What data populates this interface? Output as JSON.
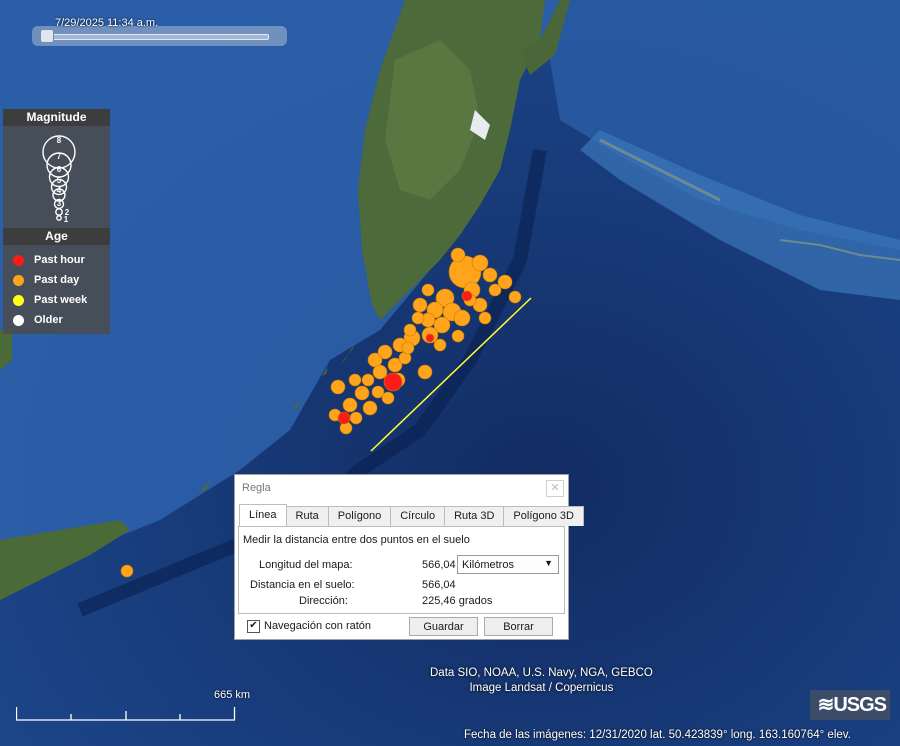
{
  "time_slider": {
    "label": "7/29/2025  11:34 a.m.",
    "position": 0.02
  },
  "legend": {
    "magnitude_title": "Magnitude",
    "magnitude_labels": [
      "8",
      "7",
      "6",
      "5",
      "4",
      "3",
      "2",
      "1"
    ],
    "age_title": "Age",
    "ages": [
      {
        "label": "Past hour",
        "color": "#ff1a1a"
      },
      {
        "label": "Past day",
        "color": "#ffa41b"
      },
      {
        "label": "Past week",
        "color": "#ffff1a"
      },
      {
        "label": "Older",
        "color": "#ffffff"
      }
    ]
  },
  "ruler_dialog": {
    "title": "Regla",
    "close_icon": "close-icon",
    "tabs": [
      "Línea",
      "Ruta",
      "Polígono",
      "Círculo",
      "Ruta 3D",
      "Polígono 3D"
    ],
    "active_tab": "Línea",
    "description": "Medir la distancia entre dos puntos en el suelo",
    "map_length_label": "Longitud del mapa:",
    "map_length_value": "566,04",
    "unit_select": "Kilómetros",
    "ground_distance_label": "Distancia en el suelo:",
    "ground_distance_value": "566,04",
    "direction_label": "Dirección:",
    "direction_value": "225,46 grados",
    "mouse_nav_label": "Navegación con ratón",
    "mouse_nav_checked": true,
    "save_button": "Guardar",
    "clear_button": "Borrar"
  },
  "map": {
    "attribution_line1": "Data SIO, NOAA, U.S. Navy, NGA, GEBCO",
    "attribution_line2": "Image Landsat / Copernicus",
    "scale_label": "665 km",
    "logo_text": "≋USGS",
    "status_text": "Fecha de las imágenes: 12/31/2020     lat.   50.423839°  long.  163.160764°   elev."
  },
  "colors": {
    "ocean": "#0e2f66",
    "land": "#4d6b3a",
    "quake_day": "#ffa41b",
    "quake_hour": "#ff1a1a",
    "ruler_line": "#ffff33"
  }
}
